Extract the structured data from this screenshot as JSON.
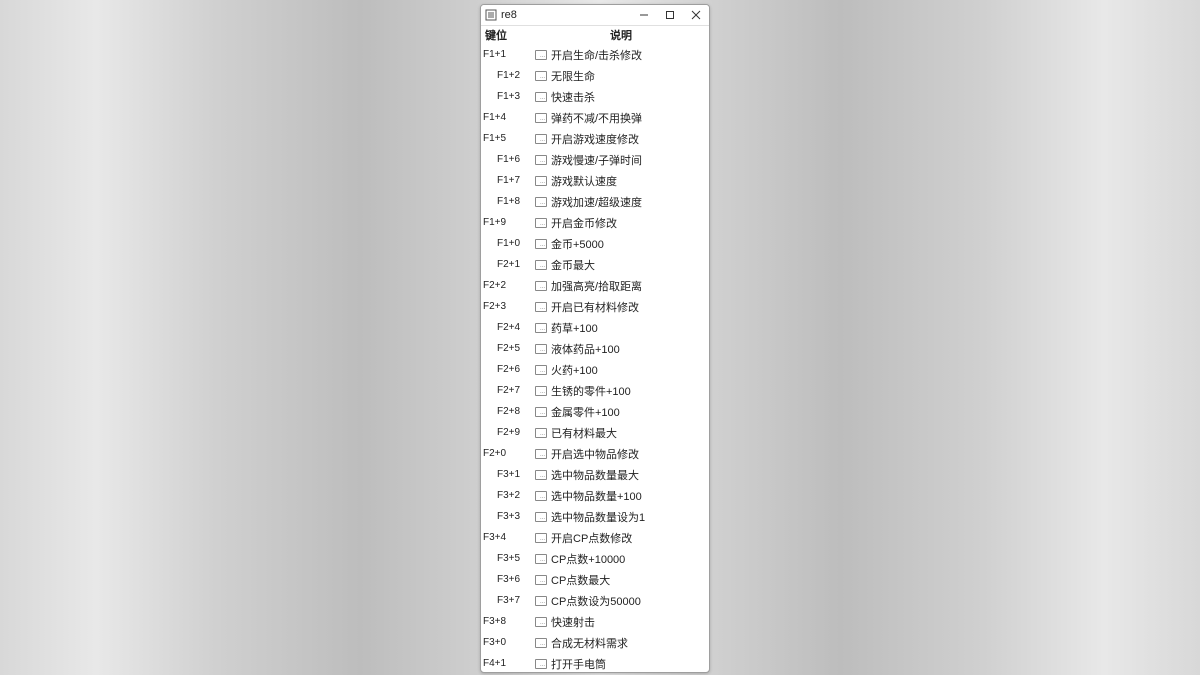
{
  "window": {
    "title": "re8"
  },
  "headers": {
    "key": "键位",
    "desc": "说明"
  },
  "rows": [
    {
      "key": "F1+1",
      "desc": "开启生命/击杀修改",
      "indent": false
    },
    {
      "key": "F1+2",
      "desc": "无限生命",
      "indent": true
    },
    {
      "key": "F1+3",
      "desc": "快速击杀",
      "indent": true
    },
    {
      "key": "F1+4",
      "desc": "弹药不减/不用换弹",
      "indent": false
    },
    {
      "key": "F1+5",
      "desc": "开启游戏速度修改",
      "indent": false
    },
    {
      "key": "F1+6",
      "desc": "游戏慢速/子弹时间",
      "indent": true
    },
    {
      "key": "F1+7",
      "desc": "游戏默认速度",
      "indent": true
    },
    {
      "key": "F1+8",
      "desc": "游戏加速/超级速度",
      "indent": true
    },
    {
      "key": "F1+9",
      "desc": "开启金币修改",
      "indent": false
    },
    {
      "key": "F1+0",
      "desc": "金币+5000",
      "indent": true
    },
    {
      "key": "F2+1",
      "desc": "金币最大",
      "indent": true
    },
    {
      "key": "F2+2",
      "desc": "加强高亮/拾取距离",
      "indent": false
    },
    {
      "key": "F2+3",
      "desc": "开启已有材料修改",
      "indent": false
    },
    {
      "key": "F2+4",
      "desc": "药草+100",
      "indent": true
    },
    {
      "key": "F2+5",
      "desc": "液体药品+100",
      "indent": true
    },
    {
      "key": "F2+6",
      "desc": "火药+100",
      "indent": true
    },
    {
      "key": "F2+7",
      "desc": "生锈的零件+100",
      "indent": true
    },
    {
      "key": "F2+8",
      "desc": "金属零件+100",
      "indent": true
    },
    {
      "key": "F2+9",
      "desc": "已有材料最大",
      "indent": true
    },
    {
      "key": "F2+0",
      "desc": "开启选中物品修改",
      "indent": false
    },
    {
      "key": "F3+1",
      "desc": "选中物品数量最大",
      "indent": true
    },
    {
      "key": "F3+2",
      "desc": "选中物品数量+100",
      "indent": true
    },
    {
      "key": "F3+3",
      "desc": "选中物品数量设为1",
      "indent": true
    },
    {
      "key": "F3+4",
      "desc": "开启CP点数修改",
      "indent": false
    },
    {
      "key": "F3+5",
      "desc": "CP点数+10000",
      "indent": true
    },
    {
      "key": "F3+6",
      "desc": "CP点数最大",
      "indent": true
    },
    {
      "key": "F3+7",
      "desc": "CP点数设为50000",
      "indent": true
    },
    {
      "key": "F3+8",
      "desc": "快速射击",
      "indent": false
    },
    {
      "key": "F3+0",
      "desc": "合成无材料需求",
      "indent": false
    },
    {
      "key": "F4+1",
      "desc": "打开手电筒",
      "indent": false
    }
  ]
}
